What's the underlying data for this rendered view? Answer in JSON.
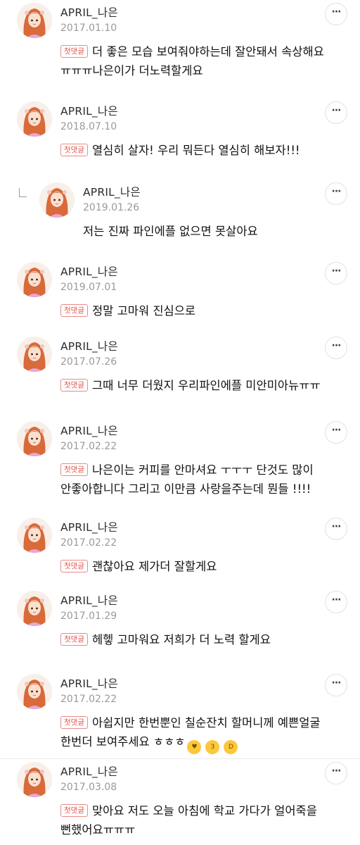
{
  "comments": [
    {
      "author": "APRIL_나은",
      "date": "2017.01.10",
      "badge": "첫댓글",
      "text": "더 좋은 모습 보여줘야하는데 잘안돼서 속상해요 ㅠㅠㅠ나은이가 더노력할게요",
      "reply": false
    },
    {
      "author": "APRIL_나은",
      "date": "2018.07.10",
      "badge": "첫댓글",
      "text": "열심히 살자! 우리 뭐든다 열심히 해보자!!!",
      "reply": false
    },
    {
      "author": "APRIL_나은",
      "date": "2019.01.26",
      "badge": "",
      "text": "저는 진짜 파인에플 없으면 못살아요",
      "reply": true
    },
    {
      "author": "APRIL_나은",
      "date": "2019.07.01",
      "badge": "첫댓글",
      "text": "정말 고마워 진심으로",
      "reply": false
    },
    {
      "author": "APRIL_나은",
      "date": "2017.07.26",
      "badge": "첫댓글",
      "text": "그때 너무 더웠지 우리파인에플 미안미아뉴ㅠㅠ",
      "reply": false
    },
    {
      "author": "APRIL_나은",
      "date": "2017.02.22",
      "badge": "첫댓글",
      "text": "나은이는 커피를 안마셔요 ㅜㅜㅜ 단것도 많이 안좋아합니다 그리고 이만큼 사랑을주는데 뭔들 !!!!",
      "reply": false
    },
    {
      "author": "APRIL_나은",
      "date": "2017.02.22",
      "badge": "첫댓글",
      "text": "괜찮아요 제가더 잘할게요",
      "reply": false
    },
    {
      "author": "APRIL_나은",
      "date": "2017.01.29",
      "badge": "첫댓글",
      "text": "헤헿 고마워요 저희가 더 노력 할게요",
      "reply": false
    },
    {
      "author": "APRIL_나은",
      "date": "2017.02.22",
      "badge": "첫댓글",
      "text": "아쉽지만 한번뿐인 칠순잔치 할머니께 예쁜얼굴 한번더 보여주세요 ㅎㅎㅎ",
      "emojis": [
        "heart-eyes",
        "kissing-face",
        "grinning-face"
      ],
      "reply": false
    },
    {
      "author": "APRIL_나은",
      "date": "2017.03.08",
      "badge": "첫댓글",
      "text": "맞아요 저도 오늘 아침에 학교 가다가 얼어죽을 뻔했어요ㅠㅠㅠ",
      "reply": false
    }
  ]
}
